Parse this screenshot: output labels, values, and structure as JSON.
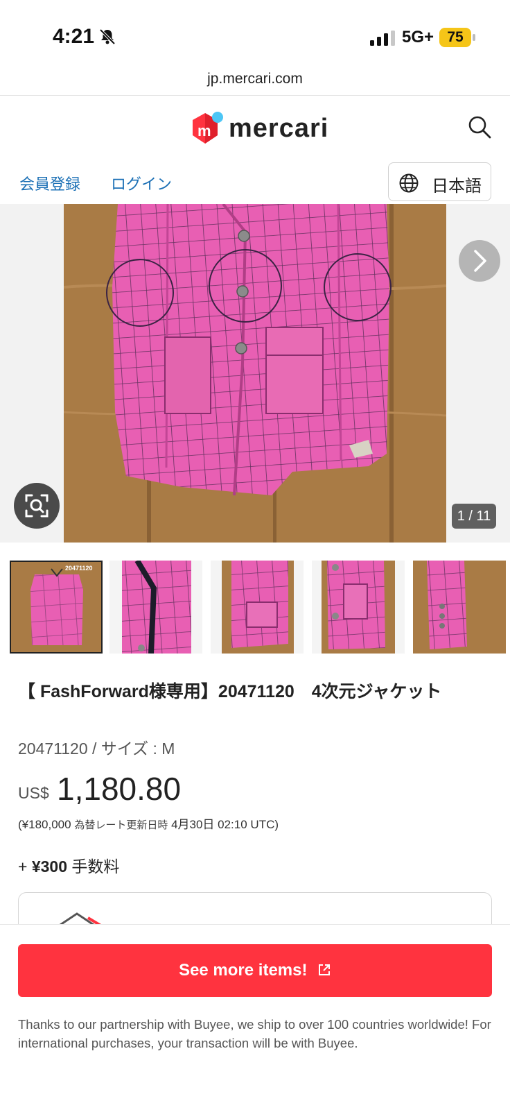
{
  "status_bar": {
    "time": "4:21",
    "network": "5G+",
    "battery": "75",
    "colors": {
      "battery_fill": "#f5c518"
    }
  },
  "browser": {
    "url": "jp.mercari.com"
  },
  "header": {
    "logo_text": "mercari",
    "logo_mark_letter": "m",
    "colors": {
      "brand_red": "#ff333f",
      "brand_blue": "#4dc6f5"
    }
  },
  "nav": {
    "register": "会員登録",
    "login": "ログイン",
    "language": "日本語",
    "colors": {
      "link": "#1a6fb5"
    }
  },
  "gallery": {
    "counter": "1 / 11",
    "thumbnail_label": "20471120"
  },
  "product": {
    "title": "【 FashForward様専用】20471120　4次元ジャケット",
    "subtitle": "20471120 / サイズ : M",
    "currency": "US$",
    "price": "1,180.80",
    "fx_open": "(",
    "fx_yen": "¥180,000",
    "fx_label": "為替レート更新日時",
    "fx_date": "4月30日 02:10 UTC",
    "fx_close": ")",
    "fee_plus": "+",
    "fee_amount": "¥300",
    "fee_label": "手数料"
  },
  "cta": {
    "label": "See more items!",
    "note": "Thanks to our partnership with Buyee, we ship to over 100 countries worldwide! For international purchases, your transaction will be with Buyee."
  }
}
